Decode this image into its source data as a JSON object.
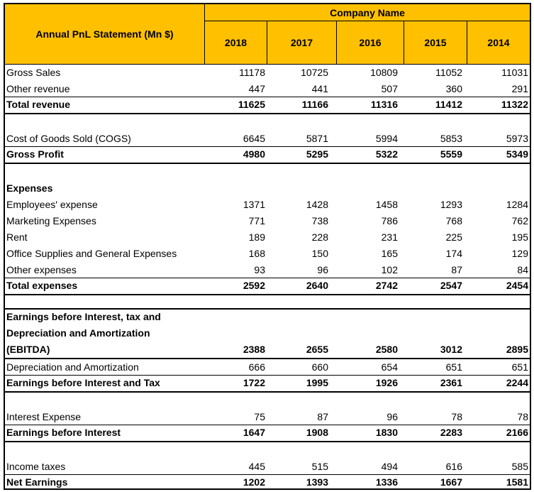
{
  "header": {
    "title": "Annual PnL Statement (Mn $)",
    "company": "Company Name",
    "years": [
      "2018",
      "2017",
      "2016",
      "2015",
      "2014"
    ]
  },
  "accent_color": "#FFC000",
  "rows": {
    "gross_sales": {
      "label": "Gross Sales",
      "values": [
        "11178",
        "10725",
        "10809",
        "11052",
        "11031"
      ]
    },
    "other_revenue": {
      "label": "Other revenue",
      "values": [
        "447",
        "441",
        "507",
        "360",
        "291"
      ]
    },
    "total_revenue": {
      "label": "Total revenue",
      "values": [
        "11625",
        "11166",
        "11316",
        "11412",
        "11322"
      ]
    },
    "cogs": {
      "label": "Cost of Goods Sold (COGS)",
      "values": [
        "6645",
        "5871",
        "5994",
        "5853",
        "5973"
      ]
    },
    "gross_profit": {
      "label": "Gross Profit",
      "values": [
        "4980",
        "5295",
        "5322",
        "5559",
        "5349"
      ]
    },
    "expenses_heading": {
      "label": "Expenses"
    },
    "employees": {
      "label": "Employees' expense",
      "values": [
        "1371",
        "1428",
        "1458",
        "1293",
        "1284"
      ]
    },
    "marketing": {
      "label": "Marketing Expenses",
      "values": [
        "771",
        "738",
        "786",
        "768",
        "762"
      ]
    },
    "rent": {
      "label": "Rent",
      "values": [
        "189",
        "228",
        "231",
        "225",
        "195"
      ]
    },
    "office": {
      "label": "Office Supplies and General Expenses",
      "values": [
        "168",
        "150",
        "165",
        "174",
        "129"
      ]
    },
    "other_exp": {
      "label": "Other expenses",
      "values": [
        "93",
        "96",
        "102",
        "87",
        "84"
      ]
    },
    "total_exp": {
      "label": "Total expenses",
      "values": [
        "2592",
        "2640",
        "2742",
        "2547",
        "2454"
      ]
    },
    "ebitda": {
      "label_line1": "Earnings before Interest, tax and",
      "label_line2": "Depreciation and Amortization",
      "label_line3": "(EBITDA)",
      "values": [
        "2388",
        "2655",
        "2580",
        "3012",
        "2895"
      ]
    },
    "da": {
      "label": "Depreciation and Amortization",
      "values": [
        "666",
        "660",
        "654",
        "651",
        "651"
      ]
    },
    "ebit": {
      "label": "Earnings before Interest and Tax",
      "values": [
        "1722",
        "1995",
        "1926",
        "2361",
        "2244"
      ]
    },
    "interest": {
      "label": "Interest Expense",
      "values": [
        "75",
        "87",
        "96",
        "78",
        "78"
      ]
    },
    "ebi": {
      "label": "Earnings before Interest",
      "values": [
        "1647",
        "1908",
        "1830",
        "2283",
        "2166"
      ]
    },
    "taxes": {
      "label": "Income taxes",
      "values": [
        "445",
        "515",
        "494",
        "616",
        "585"
      ]
    },
    "net": {
      "label": "Net Earnings",
      "values": [
        "1202",
        "1393",
        "1336",
        "1667",
        "1581"
      ]
    }
  }
}
